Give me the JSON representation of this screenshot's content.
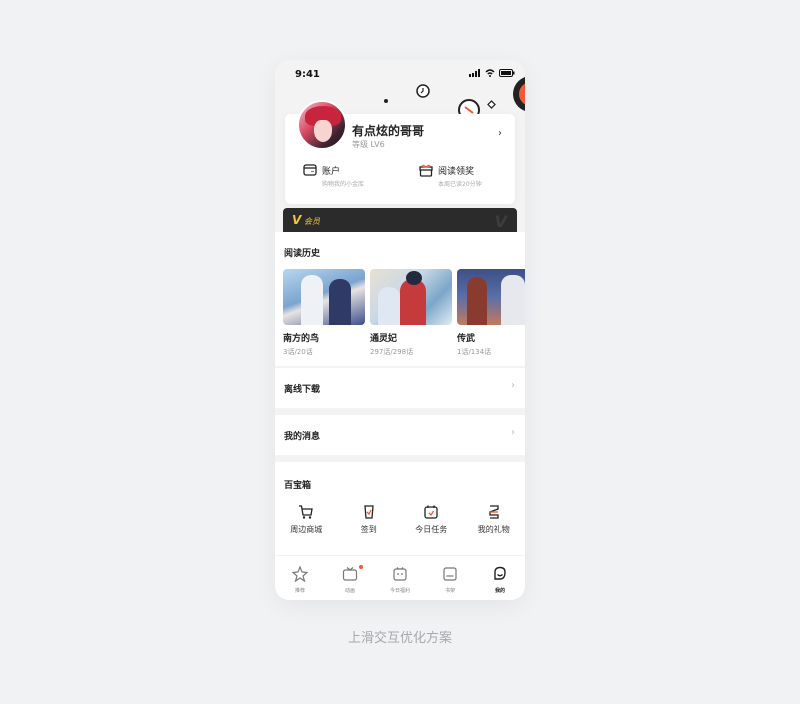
{
  "status_bar": {
    "time": "9:41"
  },
  "profile": {
    "name": "有点炫的哥哥",
    "level": "等级 LV6",
    "account": {
      "label": "账户",
      "sub": "购物我的小金库"
    },
    "reading_reward": {
      "label": "阅读领奖",
      "sub": "本周已读20分钟"
    }
  },
  "vip": {
    "label": "会员"
  },
  "reading_history": {
    "title": "阅读历史",
    "books": [
      {
        "title": "南方的鸟",
        "progress": "3话/20话"
      },
      {
        "title": "通灵妃",
        "progress": "297话/298话"
      },
      {
        "title": "传武",
        "progress": "1话/134话"
      }
    ]
  },
  "offline_download": {
    "label": "离线下载"
  },
  "my_messages": {
    "label": "我的消息"
  },
  "toolbox": {
    "title": "百宝箱",
    "items": [
      {
        "label": "周边商城",
        "icon": "cart-icon"
      },
      {
        "label": "签到",
        "icon": "checkin-icon"
      },
      {
        "label": "今日任务",
        "icon": "task-icon"
      },
      {
        "label": "我的礼物",
        "icon": "gift-icon"
      }
    ]
  },
  "tabbar": {
    "items": [
      {
        "label": "推荐",
        "icon": "recommend-icon"
      },
      {
        "label": "动画",
        "icon": "tv-icon",
        "badge": true
      },
      {
        "label": "今日福利",
        "icon": "bonus-icon"
      },
      {
        "label": "书架",
        "icon": "bookshelf-icon"
      },
      {
        "label": "我的",
        "icon": "me-icon",
        "active": true
      }
    ]
  },
  "caption": "上滑交互优化方案",
  "colors": {
    "accent": "#f05a36",
    "vip_gold": "#f7c52b",
    "vip_bg": "#2b2b2c"
  }
}
